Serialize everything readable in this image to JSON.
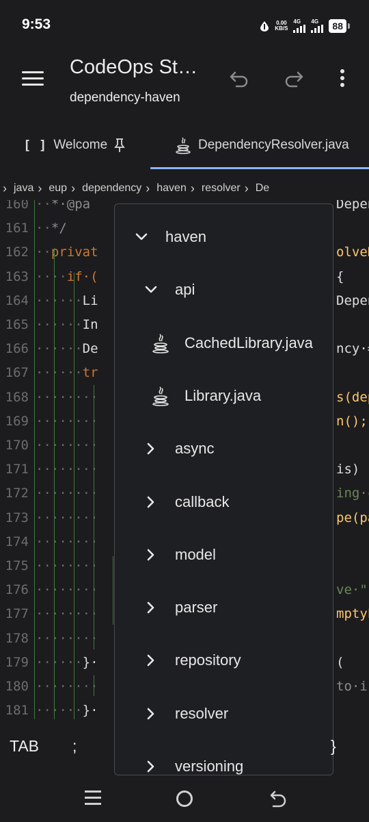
{
  "status_bar": {
    "time": "9:53",
    "speed_value": "0.00",
    "speed_unit": "KB/S",
    "net1": "4G",
    "net2": "4G",
    "battery": "88"
  },
  "app_bar": {
    "title": "CodeOps St…",
    "subtitle": "dependency-haven"
  },
  "tabs": [
    {
      "icon": "[ ]",
      "label": "Welcome"
    },
    {
      "label": "DependencyResolver.java",
      "active": true
    }
  ],
  "breadcrumb": [
    "java",
    "eup",
    "dependency",
    "haven",
    "resolver",
    "De"
  ],
  "editor": {
    "accent": "#8ab4f8",
    "lines": [
      {
        "num": "160",
        "text": "··*·@pa"
      },
      {
        "num": "161",
        "text": "··*/"
      },
      {
        "num": "162",
        "text": "··privat"
      },
      {
        "num": "163",
        "text": "····if·("
      },
      {
        "num": "164",
        "text": "······Li"
      },
      {
        "num": "165",
        "text": "······In"
      },
      {
        "num": "166",
        "text": "······De"
      },
      {
        "num": "167",
        "text": "······tr"
      },
      {
        "num": "168",
        "text": "········"
      },
      {
        "num": "169",
        "text": "········"
      },
      {
        "num": "170",
        "text": "········"
      },
      {
        "num": "171",
        "text": "········"
      },
      {
        "num": "172",
        "text": "········"
      },
      {
        "num": "173",
        "text": "········"
      },
      {
        "num": "174",
        "text": "········"
      },
      {
        "num": "175",
        "text": "········"
      },
      {
        "num": "176",
        "text": "········"
      },
      {
        "num": "177",
        "text": "········"
      },
      {
        "num": "178",
        "text": "········"
      },
      {
        "num": "179",
        "text": "······}·"
      },
      {
        "num": "180",
        "text": "········"
      },
      {
        "num": "181",
        "text": "······}·"
      }
    ],
    "right_fragments": [
      {
        "line": "160",
        "text": "Depende"
      },
      {
        "line": "162",
        "text": "olveD"
      },
      {
        "line": "163",
        "text": "{"
      },
      {
        "line": "164",
        "text": "Depend"
      },
      {
        "line": "166",
        "text": "ncy·="
      },
      {
        "line": "168",
        "text": "s(dep"
      },
      {
        "line": "169",
        "text": "n();"
      },
      {
        "line": "171",
        "text": "is)"
      },
      {
        "line": "172",
        "text": "ing·c"
      },
      {
        "line": "173",
        "text": "pe(pa"
      },
      {
        "line": "176",
        "text": "ve·\""
      },
      {
        "line": "177",
        "text": "mptyL"
      },
      {
        "line": "179",
        "text": "("
      },
      {
        "line": "180",
        "text": "to·i"
      }
    ]
  },
  "tree": {
    "items": [
      {
        "label": "haven",
        "type": "folder",
        "expanded": true,
        "depth": 0
      },
      {
        "label": "api",
        "type": "folder",
        "expanded": true,
        "depth": 1
      },
      {
        "label": "CachedLibrary.java",
        "type": "java",
        "depth": 2
      },
      {
        "label": "Library.java",
        "type": "java",
        "depth": 2
      },
      {
        "label": "async",
        "type": "folder",
        "expanded": false,
        "depth": 1
      },
      {
        "label": "callback",
        "type": "folder",
        "expanded": false,
        "depth": 1
      },
      {
        "label": "model",
        "type": "folder",
        "expanded": false,
        "depth": 1
      },
      {
        "label": "parser",
        "type": "folder",
        "expanded": false,
        "depth": 1
      },
      {
        "label": "repository",
        "type": "folder",
        "expanded": false,
        "depth": 1
      },
      {
        "label": "resolver",
        "type": "folder",
        "expanded": false,
        "depth": 1
      },
      {
        "label": "versioning",
        "type": "folder",
        "expanded": false,
        "depth": 1
      }
    ]
  },
  "bottom_keys": {
    "tab": "TAB",
    "semicolon": ";",
    "brace": "}"
  }
}
